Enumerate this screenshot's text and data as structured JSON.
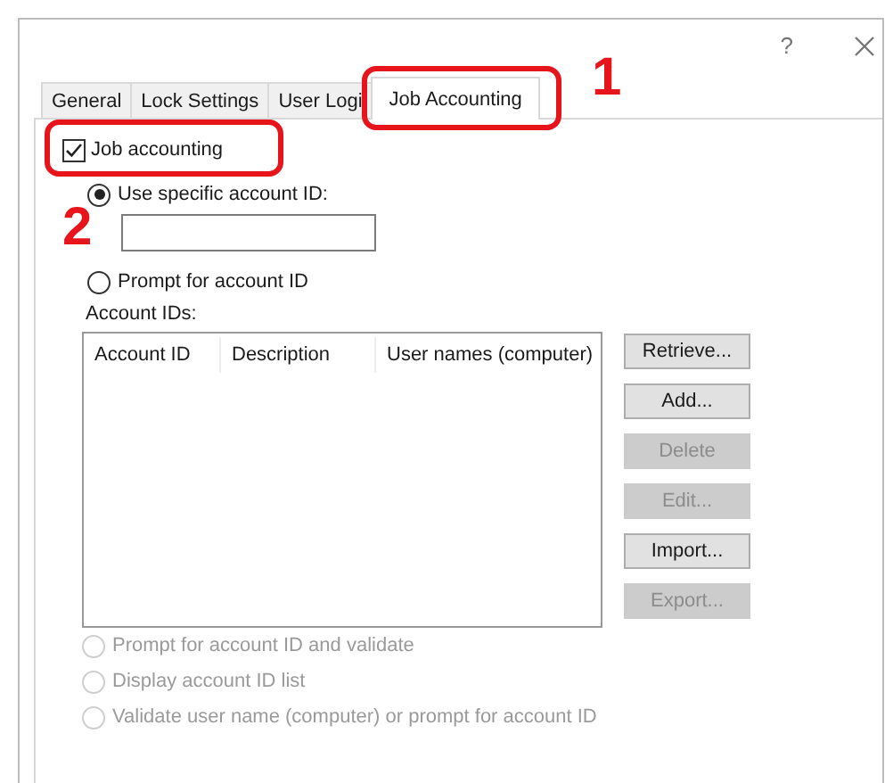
{
  "window": {
    "help": "?"
  },
  "tabs": [
    {
      "label": "General",
      "selected": false,
      "highlighted": false
    },
    {
      "label": "Lock Settings",
      "selected": false,
      "highlighted": false
    },
    {
      "label": "User Logi",
      "selected": false,
      "highlighted": false
    },
    {
      "label": "Job Accounting",
      "selected": true,
      "highlighted": true,
      "step": "1"
    }
  ],
  "job_accounting": {
    "label": "Job accounting",
    "checked": true,
    "highlighted": true
  },
  "id_modes": [
    {
      "label": "Use specific account ID:",
      "selected": true,
      "disabled": false
    },
    {
      "label": "Prompt for account ID",
      "selected": false,
      "disabled": false
    }
  ],
  "account_id_field": {
    "step": "2"
  },
  "account_ids": {
    "label": "Account IDs:",
    "columns": [
      "Account ID",
      "Description",
      "User names (computer)"
    ]
  },
  "buttons": [
    {
      "label": "Retrieve...",
      "disabled": false
    },
    {
      "label": "Add...",
      "disabled": false
    },
    {
      "label": "Delete",
      "disabled": true
    },
    {
      "label": "Edit...",
      "disabled": true
    },
    {
      "label": "Import...",
      "disabled": false
    },
    {
      "label": "Export...",
      "disabled": true
    }
  ],
  "validation_modes": [
    {
      "label": "Prompt for account ID and validate",
      "selected": false,
      "disabled": true
    },
    {
      "label": "Display account ID list",
      "selected": false,
      "disabled": true
    },
    {
      "label": "Validate user name (computer) or prompt for account ID",
      "selected": false,
      "disabled": true
    }
  ]
}
